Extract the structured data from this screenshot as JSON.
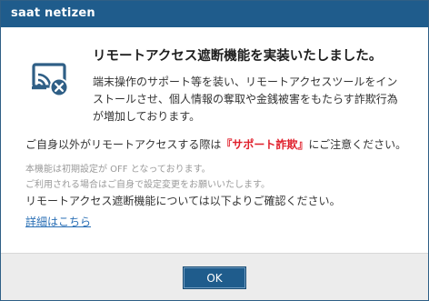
{
  "titlebar": {
    "brand": "saat netizen"
  },
  "dialog": {
    "heading": "リモートアクセス遮断機能を実装いたしました。",
    "description": "端末操作のサポート等を装い、リモートアクセスツールをインストールさせ、個人情報の奪取や金銭被害をもたらす詐欺行為が増加しております。",
    "notice_before": "ご自身以外がリモートアクセスする際は",
    "notice_emphasis": "『サポート詐欺』",
    "notice_after": "にご注意ください。",
    "sub_line1": "本機能は初期設定が OFF となっております。",
    "sub_line2": "ご利用される場合はご自身で設定変更をお願いいたします。",
    "info": "リモートアクセス遮断機能については以下よりご確認ください。",
    "details_link": "詳細はこちら"
  },
  "footer": {
    "ok_label": "OK"
  },
  "icon": {
    "name": "remote-access-blocked-icon",
    "color": "#2f5f86"
  },
  "colors": {
    "titlebar": "#1f5c8c",
    "emphasis": "#e0202c",
    "link": "#2a6fb5",
    "footer": "#ececec"
  }
}
